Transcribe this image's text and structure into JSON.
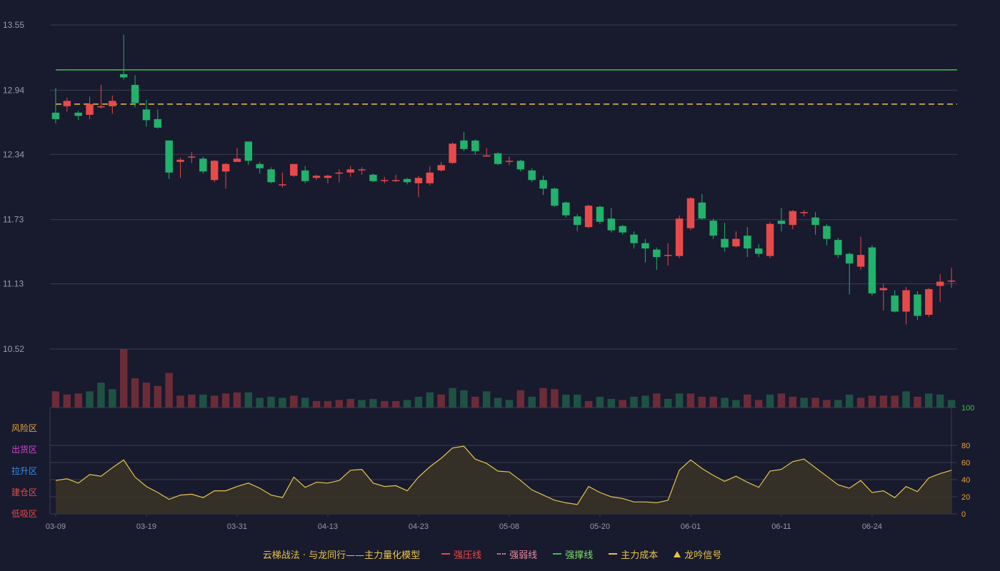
{
  "chart_data": {
    "type": "candlestick",
    "main": {
      "yticks": [
        10.52,
        11.13,
        11.73,
        12.34,
        12.94,
        13.55
      ],
      "ylim": [
        10.52,
        13.55
      ],
      "xtick_labels": [
        "03-09",
        "03-19",
        "03-31",
        "04-13",
        "04-23",
        "05-08",
        "05-20",
        "06-01",
        "06-11",
        "06-24"
      ],
      "xtick_index": [
        0,
        8,
        16,
        24,
        32,
        40,
        48,
        56,
        64,
        72
      ],
      "hlines": [
        {
          "name": "强撑线",
          "value": 13.13,
          "color": "#3fbf4f",
          "style": "solid"
        },
        {
          "name": "主力成本",
          "value": 12.81,
          "color": "#e8c54a",
          "style": "dashed"
        }
      ],
      "candles": [
        [
          12.73,
          12.67,
          12.96,
          12.63
        ],
        [
          12.79,
          12.84,
          12.87,
          12.74
        ],
        [
          12.73,
          12.7,
          12.75,
          12.66
        ],
        [
          12.71,
          12.81,
          12.88,
          12.67
        ],
        [
          12.78,
          12.79,
          12.99,
          12.77
        ],
        [
          12.79,
          12.84,
          12.89,
          12.72
        ],
        [
          13.09,
          13.06,
          13.46,
          13.04
        ],
        [
          12.99,
          12.82,
          13.08,
          12.78
        ],
        [
          12.76,
          12.66,
          12.85,
          12.6
        ],
        [
          12.67,
          12.59,
          12.76,
          12.58
        ],
        [
          12.47,
          12.17,
          12.47,
          12.11
        ],
        [
          12.27,
          12.29,
          12.31,
          12.12
        ],
        [
          12.32,
          12.32,
          12.36,
          12.26
        ],
        [
          12.3,
          12.18,
          12.32,
          12.16
        ],
        [
          12.1,
          12.28,
          12.29,
          12.08
        ],
        [
          12.18,
          12.25,
          12.26,
          12.02
        ],
        [
          12.27,
          12.3,
          12.4,
          12.28
        ],
        [
          12.46,
          12.28,
          12.46,
          12.24
        ],
        [
          12.25,
          12.21,
          12.27,
          12.16
        ],
        [
          12.2,
          12.08,
          12.22,
          12.07
        ],
        [
          12.06,
          12.06,
          12.17,
          12.03
        ],
        [
          12.14,
          12.25,
          12.25,
          12.13
        ],
        [
          12.19,
          12.09,
          12.23,
          12.07
        ],
        [
          12.12,
          12.14,
          12.15,
          12.1
        ],
        [
          12.12,
          12.14,
          12.15,
          12.07
        ],
        [
          12.16,
          12.17,
          12.2,
          12.08
        ],
        [
          12.17,
          12.2,
          12.23,
          12.13
        ],
        [
          12.2,
          12.2,
          12.22,
          12.15
        ],
        [
          12.15,
          12.09,
          12.16,
          12.08
        ],
        [
          12.09,
          12.1,
          12.13,
          12.07
        ],
        [
          12.09,
          12.1,
          12.15,
          12.08
        ],
        [
          12.11,
          12.08,
          12.12,
          12.06
        ],
        [
          12.07,
          12.12,
          12.14,
          11.94
        ],
        [
          12.07,
          12.17,
          12.23,
          12.05
        ],
        [
          12.19,
          12.24,
          12.27,
          12.18
        ],
        [
          12.26,
          12.44,
          12.45,
          12.25
        ],
        [
          12.47,
          12.39,
          12.55,
          12.37
        ],
        [
          12.47,
          12.37,
          12.48,
          12.34
        ],
        [
          12.33,
          12.33,
          12.4,
          12.32
        ],
        [
          12.35,
          12.25,
          12.36,
          12.24
        ],
        [
          12.27,
          12.28,
          12.32,
          12.24
        ],
        [
          12.28,
          12.2,
          12.29,
          12.18
        ],
        [
          12.19,
          12.1,
          12.21,
          12.08
        ],
        [
          12.1,
          12.02,
          12.14,
          11.96
        ],
        [
          12.02,
          11.86,
          12.03,
          11.85
        ],
        [
          11.89,
          11.77,
          11.9,
          11.75
        ],
        [
          11.76,
          11.68,
          11.78,
          11.62
        ],
        [
          11.66,
          11.86,
          11.87,
          11.65
        ],
        [
          11.85,
          11.71,
          11.86,
          11.69
        ],
        [
          11.74,
          11.63,
          11.84,
          11.61
        ],
        [
          11.67,
          11.61,
          11.68,
          11.59
        ],
        [
          11.59,
          11.51,
          11.62,
          11.46
        ],
        [
          11.51,
          11.46,
          11.55,
          11.33
        ],
        [
          11.45,
          11.38,
          11.47,
          11.26
        ],
        [
          11.4,
          11.4,
          11.51,
          11.3
        ],
        [
          11.39,
          11.74,
          11.77,
          11.37
        ],
        [
          11.65,
          11.93,
          11.94,
          11.63
        ],
        [
          11.89,
          11.74,
          11.97,
          11.73
        ],
        [
          11.72,
          11.58,
          11.74,
          11.55
        ],
        [
          11.55,
          11.47,
          11.7,
          11.43
        ],
        [
          11.48,
          11.55,
          11.62,
          11.47
        ],
        [
          11.58,
          11.46,
          11.66,
          11.38
        ],
        [
          11.46,
          11.41,
          11.5,
          11.38
        ],
        [
          11.39,
          11.69,
          11.71,
          11.37
        ],
        [
          11.72,
          11.69,
          11.84,
          11.62
        ],
        [
          11.68,
          11.81,
          11.82,
          11.64
        ],
        [
          11.79,
          11.8,
          11.82,
          11.76
        ],
        [
          11.75,
          11.68,
          11.8,
          11.59
        ],
        [
          11.67,
          11.55,
          11.69,
          11.49
        ],
        [
          11.54,
          11.4,
          11.56,
          11.37
        ],
        [
          11.41,
          11.32,
          11.42,
          11.03
        ],
        [
          11.29,
          11.4,
          11.57,
          11.26
        ],
        [
          11.47,
          11.04,
          11.49,
          11.02
        ],
        [
          11.07,
          11.09,
          11.13,
          10.88
        ],
        [
          11.02,
          10.87,
          11.07,
          10.86
        ],
        [
          10.87,
          11.07,
          11.1,
          10.75
        ],
        [
          11.03,
          10.83,
          11.06,
          10.79
        ],
        [
          10.84,
          11.08,
          11.09,
          10.82
        ],
        [
          11.11,
          11.15,
          11.22,
          10.96
        ],
        [
          11.15,
          11.16,
          11.28,
          11.09
        ]
      ],
      "volume": [
        15,
        12,
        13,
        15,
        23,
        17,
        54,
        27,
        23,
        20,
        32,
        11,
        12,
        12,
        11,
        13,
        14,
        14,
        9,
        10,
        9,
        11,
        9,
        6,
        6,
        7,
        8,
        7,
        8,
        6,
        6,
        7,
        10,
        14,
        12,
        18,
        16,
        10,
        15,
        9,
        7,
        16,
        10,
        18,
        17,
        12,
        12,
        6,
        10,
        8,
        7,
        10,
        11,
        13,
        8,
        13,
        13,
        10,
        10,
        9,
        7,
        12,
        7,
        12,
        13,
        10,
        9,
        9,
        7,
        7,
        12,
        9,
        11,
        11,
        11,
        15,
        10,
        13,
        12,
        7
      ],
      "volume_up": [
        true,
        true,
        true,
        false,
        false,
        false,
        true,
        true,
        true,
        true,
        true,
        true,
        true,
        false,
        true,
        true,
        true,
        false,
        false,
        false,
        false,
        true,
        false,
        true,
        true,
        true,
        true,
        false,
        false,
        true,
        true,
        false,
        false,
        false,
        true,
        false,
        false,
        true,
        false,
        false,
        false,
        true,
        false,
        true,
        true,
        false,
        false,
        true,
        false,
        false,
        true,
        false,
        false,
        true,
        false,
        false,
        true,
        true,
        true,
        false,
        false,
        true,
        true,
        false,
        true,
        true,
        false,
        true,
        true,
        false,
        false,
        true,
        true,
        true,
        true,
        false,
        true,
        false,
        false,
        false
      ]
    },
    "indicator": {
      "ylim": [
        0,
        100
      ],
      "yticks_right": [
        0,
        20,
        40,
        60,
        80,
        100
      ],
      "zones_left": [
        {
          "label": "风险区",
          "color": "#e8a33a"
        },
        {
          "label": "出货区",
          "color": "#d046d0"
        },
        {
          "label": "拉升区",
          "color": "#3a8fe8"
        },
        {
          "label": "建仓区",
          "color": "#e84a4a"
        },
        {
          "label": "低吸区",
          "color": "#e84a4a"
        }
      ],
      "values": [
        39,
        41,
        36,
        46,
        44,
        54,
        63,
        43,
        32,
        25,
        17,
        22,
        23,
        19,
        27,
        27,
        32,
        36,
        30,
        22,
        19,
        43,
        31,
        37,
        36,
        39,
        51,
        52,
        36,
        32,
        33,
        27,
        43,
        55,
        65,
        77,
        79,
        64,
        59,
        50,
        49,
        39,
        28,
        22,
        16,
        13,
        11,
        32,
        25,
        20,
        18,
        14,
        14,
        13,
        16,
        51,
        63,
        53,
        45,
        38,
        44,
        37,
        31,
        50,
        52,
        61,
        64,
        54,
        44,
        34,
        30,
        39,
        25,
        27,
        19,
        32,
        26,
        42,
        47,
        51
      ]
    }
  },
  "legend": {
    "title": "云梯战法 · 与龙同行——主力量化模型",
    "items": [
      {
        "label": "强压线",
        "color": "#e84a4a",
        "style": "solid"
      },
      {
        "label": "强弱线",
        "color": "#e84a4a",
        "style": "dotted"
      },
      {
        "label": "强撑线",
        "color": "#3fbf4f",
        "style": "solid"
      },
      {
        "label": "主力成本",
        "color": "#e8c54a",
        "style": "dashed"
      },
      {
        "label": "龙吟信号",
        "color": "#e8c54a",
        "style": "triangle"
      }
    ]
  },
  "colors": {
    "up": "#e84a4a",
    "down": "#21b26b",
    "vol_up": "#6b2c38",
    "vol_down": "#1e5244",
    "grid": "#3a3c52",
    "axis_text": "#9a9ab0",
    "line": "#e8c54a"
  }
}
